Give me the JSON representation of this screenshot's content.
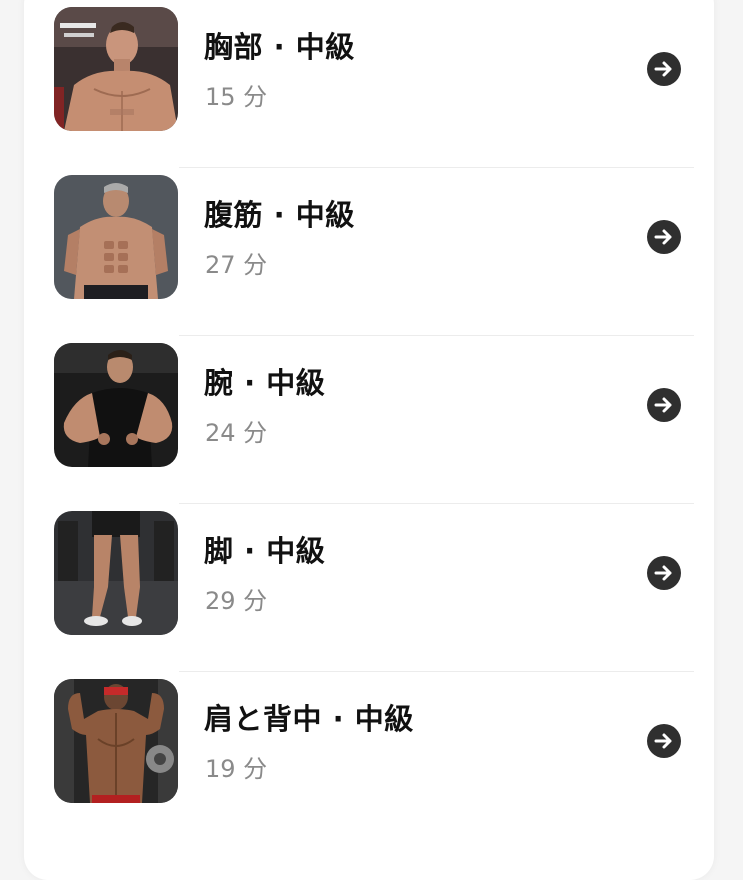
{
  "workouts": [
    {
      "title": "胸部 · 中級",
      "duration": "15 分",
      "image": "chest-workout-photo"
    },
    {
      "title": "腹筋 · 中級",
      "duration": "27 分",
      "image": "abs-workout-photo"
    },
    {
      "title": "腕 · 中級",
      "duration": "24 分",
      "image": "arms-workout-photo"
    },
    {
      "title": "脚 · 中級",
      "duration": "29 分",
      "image": "legs-workout-photo"
    },
    {
      "title": "肩と背中 · 中級",
      "duration": "19 分",
      "image": "shoulders-back-workout-photo"
    }
  ],
  "colors": {
    "title": "#111111",
    "duration": "#8a8a8a",
    "arrow_bg": "#2f2f2f",
    "arrow_fg": "#ffffff"
  },
  "icons": {
    "arrow": "arrow-right-circle-icon"
  }
}
